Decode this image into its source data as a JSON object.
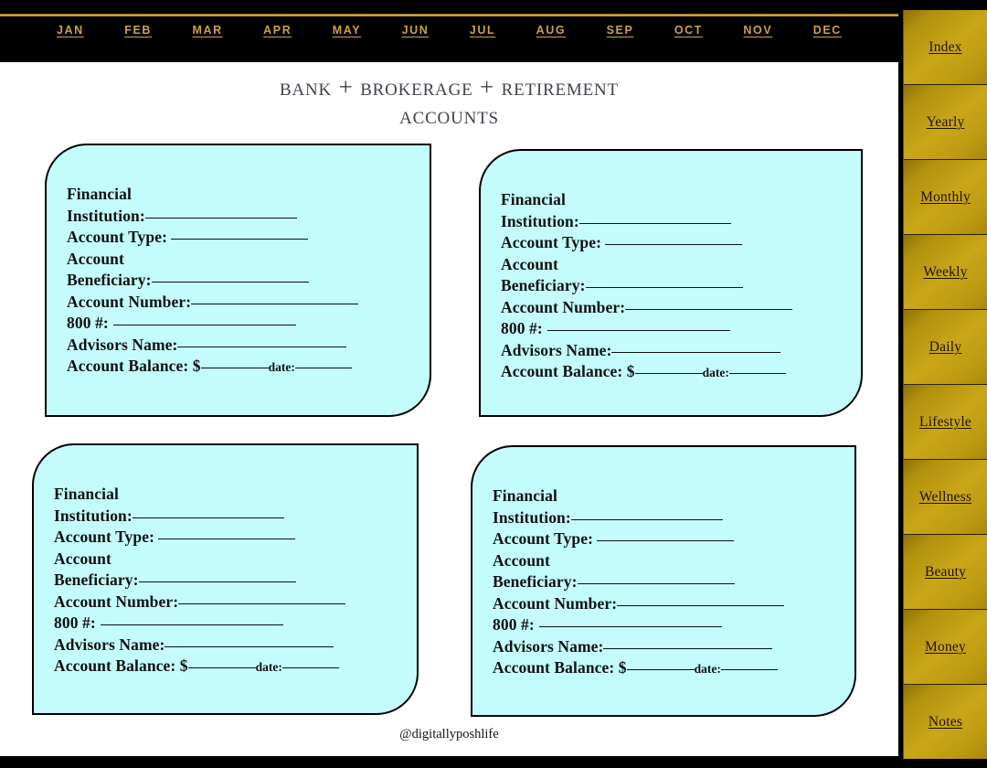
{
  "colors": {
    "nav_background": "#000000",
    "nav_gold_rule": "#d8b551",
    "month_label": "#c9a24a",
    "page_background": "#ffffff",
    "title_text": "#44414a",
    "card_fill": "#c4fcfc",
    "card_border": "#000000",
    "field_text": "#111111",
    "tab_gold": "#c9a617",
    "tab_gold_dark": "#8e7206",
    "tab_label": "#1b1405",
    "bottom_bar": "#000000"
  },
  "month_nav": {
    "months": [
      {
        "label": "JAN"
      },
      {
        "label": "FEB"
      },
      {
        "label": "MAR"
      },
      {
        "label": "APR"
      },
      {
        "label": "MAY"
      },
      {
        "label": "JUN"
      },
      {
        "label": "JUL"
      },
      {
        "label": "AUG"
      },
      {
        "label": "SEP"
      },
      {
        "label": "OCT"
      },
      {
        "label": "NOV"
      },
      {
        "label": "DEC"
      }
    ]
  },
  "header": {
    "title_line1": "BANK + BROKERAGE + RETIREMENT",
    "title_line2": "ACCOUNTS"
  },
  "fields": {
    "financial_institution_l1": "Financial",
    "financial_institution_l2": "Institution:",
    "account_type": "Account Type:",
    "account_beneficiary_l1": "Account",
    "account_beneficiary_l2": "Beneficiary:",
    "account_number": "Account Number:",
    "toll_free": "800 #:",
    "advisors_name": "Advisors Name:",
    "account_balance": "Account Balance: $",
    "date": "date:"
  },
  "cards": [
    {
      "id": "account-card-1"
    },
    {
      "id": "account-card-2"
    },
    {
      "id": "account-card-3"
    },
    {
      "id": "account-card-4"
    }
  ],
  "footer": {
    "watermark": "@digitallyposhlife"
  },
  "tab_rail": {
    "tabs": [
      {
        "label": "Index"
      },
      {
        "label": "Yearly"
      },
      {
        "label": "Monthly"
      },
      {
        "label": "Weekly"
      },
      {
        "label": "Daily"
      },
      {
        "label": "Lifestyle"
      },
      {
        "label": "Wellness"
      },
      {
        "label": "Beauty"
      },
      {
        "label": "Money"
      },
      {
        "label": "Notes"
      }
    ]
  }
}
